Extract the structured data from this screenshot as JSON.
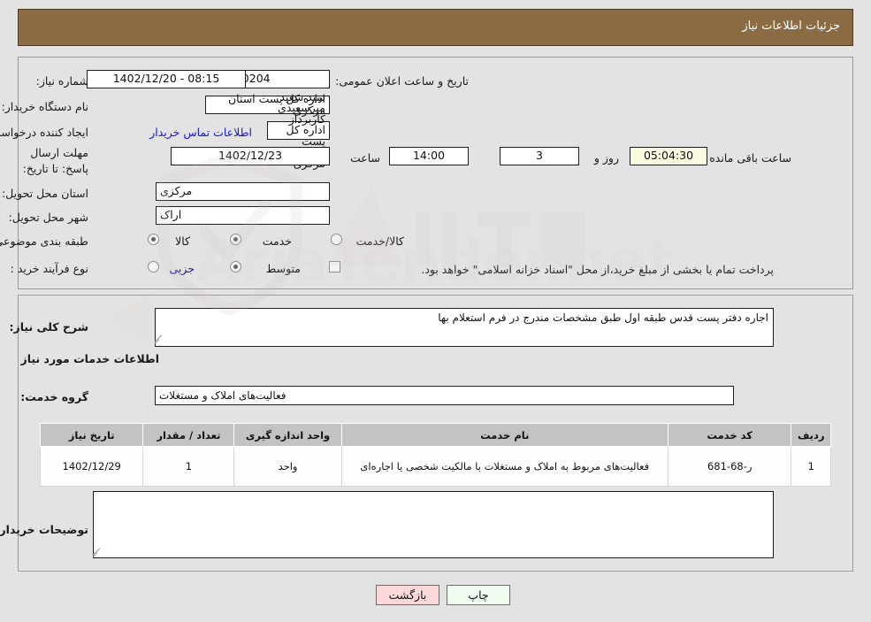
{
  "header": {
    "title": "جزئیات اطلاعات نیاز"
  },
  "watermark": {
    "text": "AriaTender.net"
  },
  "form": {
    "need_number": {
      "label": "شماره نیاز:",
      "value": "1102003235000204"
    },
    "announce_datetime": {
      "label": "تاریخ و ساعت اعلان عمومی:",
      "value": "08:15 - 1402/12/20"
    },
    "buyer_org": {
      "label": "نام دستگاه خریدار:",
      "value": "اداره کل پست استان مرکزی"
    },
    "creator": {
      "label": "ایجاد کننده درخواست:",
      "value": "سید سعید میرسعیدی کاربرداز اداره کل پست استان مرکزی"
    },
    "contact_link": {
      "label": "اطلاعات تماس خریدار"
    },
    "deadline": {
      "label": "مهلت ارسال پاسخ: تا تاریخ:",
      "date": "1402/12/23",
      "time_label": "ساعت",
      "time": "14:00",
      "days": "3",
      "days_label": "روز و",
      "countdown": "05:04:30",
      "countdown_label": "ساعت باقی مانده"
    },
    "province": {
      "label": "استان محل تحویل:",
      "value": "مرکزی"
    },
    "city": {
      "label": "شهر محل تحویل:",
      "value": "اراک"
    },
    "category": {
      "label": "طبقه بندی موضوعی:",
      "options": [
        {
          "label": "کالا",
          "selected": false
        },
        {
          "label": "خدمت",
          "selected": true
        },
        {
          "label": "کالا/خدمت",
          "selected": false
        }
      ]
    },
    "purchase_type": {
      "label": "نوع فرآیند خرید :",
      "options": [
        {
          "label": "جزیی",
          "selected": false
        },
        {
          "label": "متوسط",
          "selected": true
        }
      ],
      "checkbox_label": "پرداخت تمام یا بخشی از مبلغ خرید،از محل \"اسناد خزانه اسلامی\" خواهد بود.",
      "checkbox_checked": false
    }
  },
  "description": {
    "label": "شرح کلی نیاز:",
    "value": "اجاره دفتر پست قدس طبقه اول    طبق مشخصات مندرج در فرم استعلام بها"
  },
  "services_section": {
    "heading": "اطلاعات خدمات مورد نیاز",
    "group_label": "گروه خدمت:",
    "group_value": "فعالیت‌های  املاک و مستغلات"
  },
  "table": {
    "columns": [
      "ردیف",
      "کد خدمت",
      "نام خدمت",
      "واحد اندازه گیری",
      "تعداد / مقدار",
      "تاریخ نیاز"
    ],
    "rows": [
      {
        "radif": "1",
        "code": "ر-68-681",
        "name": "فعالیت‌های مربوط به املاک و مستغلات با مالکیت شخصی یا اجاره‌ای",
        "unit": "واحد",
        "qty": "1",
        "date": "1402/12/29"
      }
    ]
  },
  "buyer_notes": {
    "label": "توضیحات خریدار:",
    "value": ""
  },
  "buttons": {
    "print": "چاپ",
    "back": "بازگشت"
  },
  "colors": {
    "header_bg": "#8b6b43",
    "link": "#1414dd",
    "countdown_bg": "#fbfbe2",
    "print_bg": "#eefbee",
    "back_bg": "#fbd9d9",
    "table_header_bg": "#c3c3c3"
  }
}
